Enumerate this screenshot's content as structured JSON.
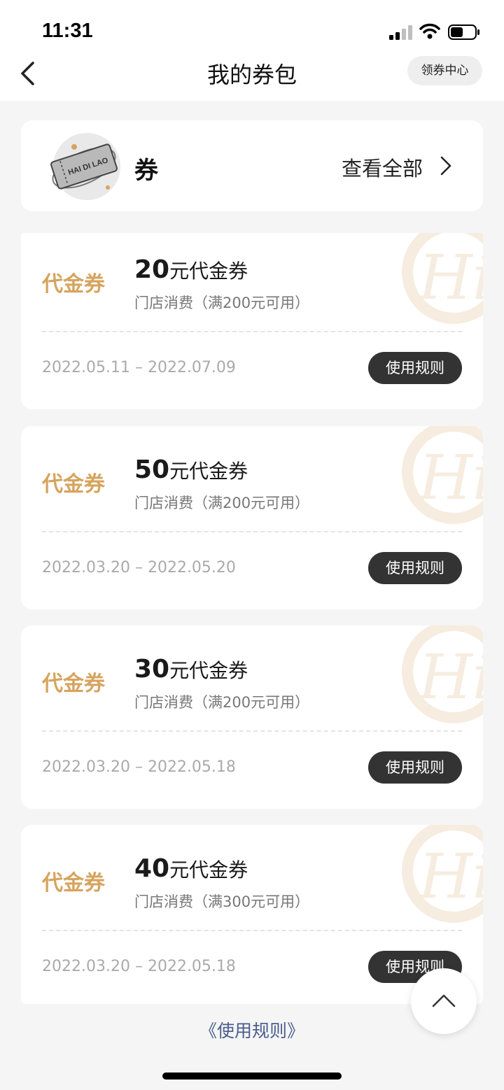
{
  "status_bar": {
    "time": "11:31"
  },
  "nav": {
    "title": "我的券包",
    "coupon_center_label": "领券中心"
  },
  "summary": {
    "label": "券",
    "view_all_label": "查看全部",
    "art_text": "HAI DI LAO"
  },
  "coupons": [
    {
      "tag": "代金券",
      "amount": "20",
      "title_suffix": "元代金券",
      "condition": "门店消费（满200元可用）",
      "dates": "2022.05.11 – 2022.07.09",
      "rules_label": "使用规则"
    },
    {
      "tag": "代金券",
      "amount": "50",
      "title_suffix": "元代金券",
      "condition": "门店消费（满200元可用）",
      "dates": "2022.03.20 – 2022.05.20",
      "rules_label": "使用规则"
    },
    {
      "tag": "代金券",
      "amount": "30",
      "title_suffix": "元代金券",
      "condition": "门店消费（满200元可用）",
      "dates": "2022.03.20 – 2022.05.18",
      "rules_label": "使用规则"
    },
    {
      "tag": "代金券",
      "amount": "40",
      "title_suffix": "元代金券",
      "condition": "门店消费（满300元可用）",
      "dates": "2022.03.20 – 2022.05.18",
      "rules_label": "使用规则"
    }
  ],
  "footer": {
    "rules_link": "《使用规则》"
  },
  "colors": {
    "accent_gold": "#d6a45f",
    "button_dark": "#333333",
    "link_blue": "#4a5d8c"
  },
  "icons": {
    "back": "chevron-left-icon",
    "view_all": "chevron-right-icon",
    "scroll_top": "chevron-up-icon"
  }
}
